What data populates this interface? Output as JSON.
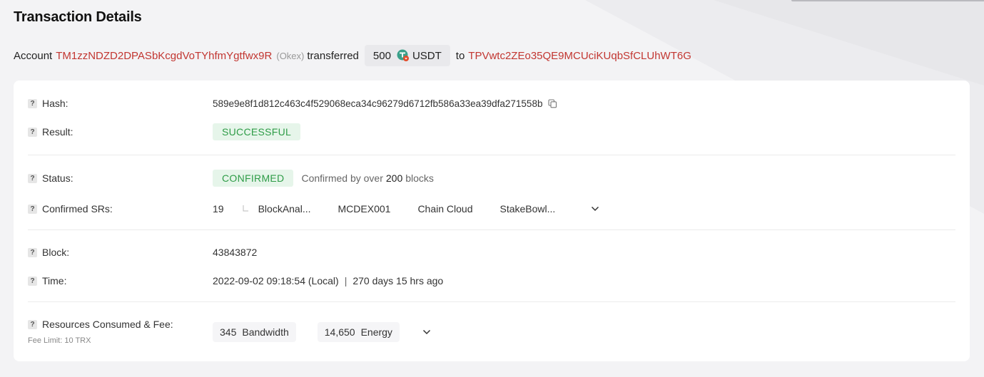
{
  "header": {
    "title": "Transaction Details"
  },
  "summary": {
    "account_word": "Account",
    "from_address": "TM1zzNDZD2DPASbKcgdVoTYhfmYgtfwx9R",
    "from_tag": "(Okex)",
    "action": "transferred",
    "amount": "500",
    "token": "USDT",
    "to_word": "to",
    "to_address": "TPVwtc2ZEo35QE9MCUciKUqbSfCLUhWT6G"
  },
  "details": {
    "hash": {
      "label": "Hash:",
      "value": "589e9e8f1d812c463c4f529068eca34c96279d6712fb586a33ea39dfa271558b"
    },
    "result": {
      "label": "Result:",
      "value": "SUCCESSFUL"
    },
    "status": {
      "label": "Status:",
      "value": "CONFIRMED",
      "note_prefix": "Confirmed by over",
      "note_count": "200",
      "note_suffix": "blocks"
    },
    "confirmed_srs": {
      "label": "Confirmed SRs:",
      "count": "19",
      "items": [
        "BlockAnal...",
        "MCDEX001",
        "Chain Cloud",
        "StakeBowl..."
      ]
    },
    "block": {
      "label": "Block:",
      "value": "43843872"
    },
    "time": {
      "label": "Time:",
      "value": "2022-09-02 09:18:54 (Local)",
      "separator": "|",
      "ago": "270 days 15 hrs ago"
    },
    "resources": {
      "label": "Resources Consumed & Fee:",
      "fee_limit": "Fee Limit: 10 TRX",
      "bandwidth_value": "345",
      "bandwidth_label": "Bandwidth",
      "energy_value": "14,650",
      "energy_label": "Energy"
    }
  },
  "colors": {
    "address": "#c23631",
    "success_bg": "#e6f5ea",
    "success_text": "#2e9c47"
  },
  "icons": {
    "help": "question-icon",
    "copy": "copy-icon",
    "expand": "chevron-down-icon",
    "token": "tether-token-icon"
  }
}
